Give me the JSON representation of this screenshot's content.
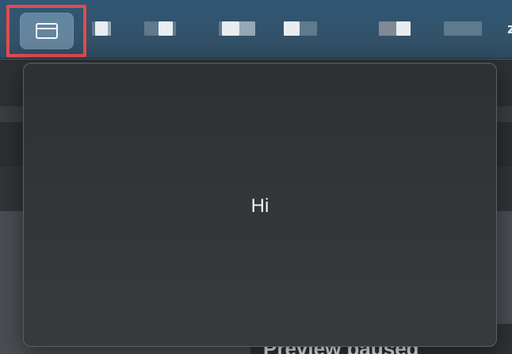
{
  "menubar": {
    "window_button": {
      "icon": "window-icon"
    },
    "blurred_items": [
      "",
      "",
      "",
      "",
      "",
      ""
    ],
    "trailing_text": "z"
  },
  "popover": {
    "message": "Hi"
  },
  "background": {
    "status_label": "Preview paused"
  },
  "colors": {
    "highlight_border": "#e34b4b",
    "menubar": "#2f5775",
    "popover_bg": "#34363a"
  }
}
